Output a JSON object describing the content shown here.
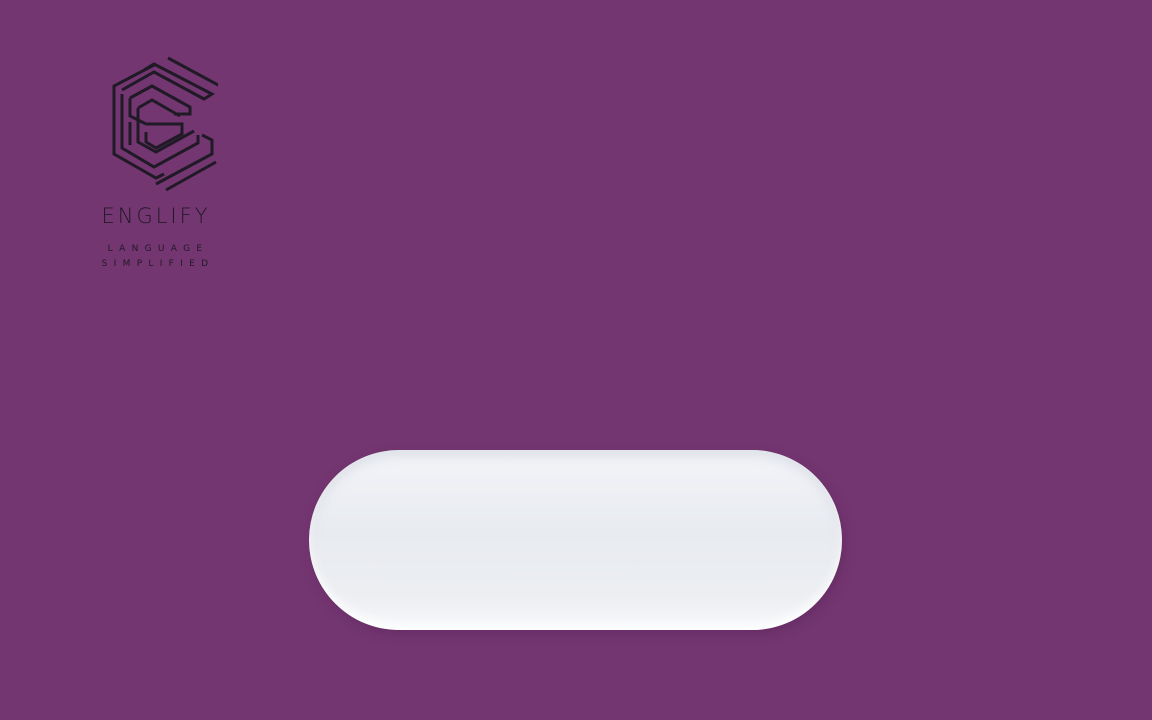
{
  "brand": {
    "name": "ENGLIFY",
    "tagline_line1": "LANGUAGE",
    "tagline_line2": "SIMPLIFIED",
    "logo_icon": "hexagon-e-icon"
  },
  "colors": {
    "background": "#743671",
    "logo": "#1f1a26",
    "pill": "#eceef2"
  },
  "pill": {
    "label": ""
  }
}
